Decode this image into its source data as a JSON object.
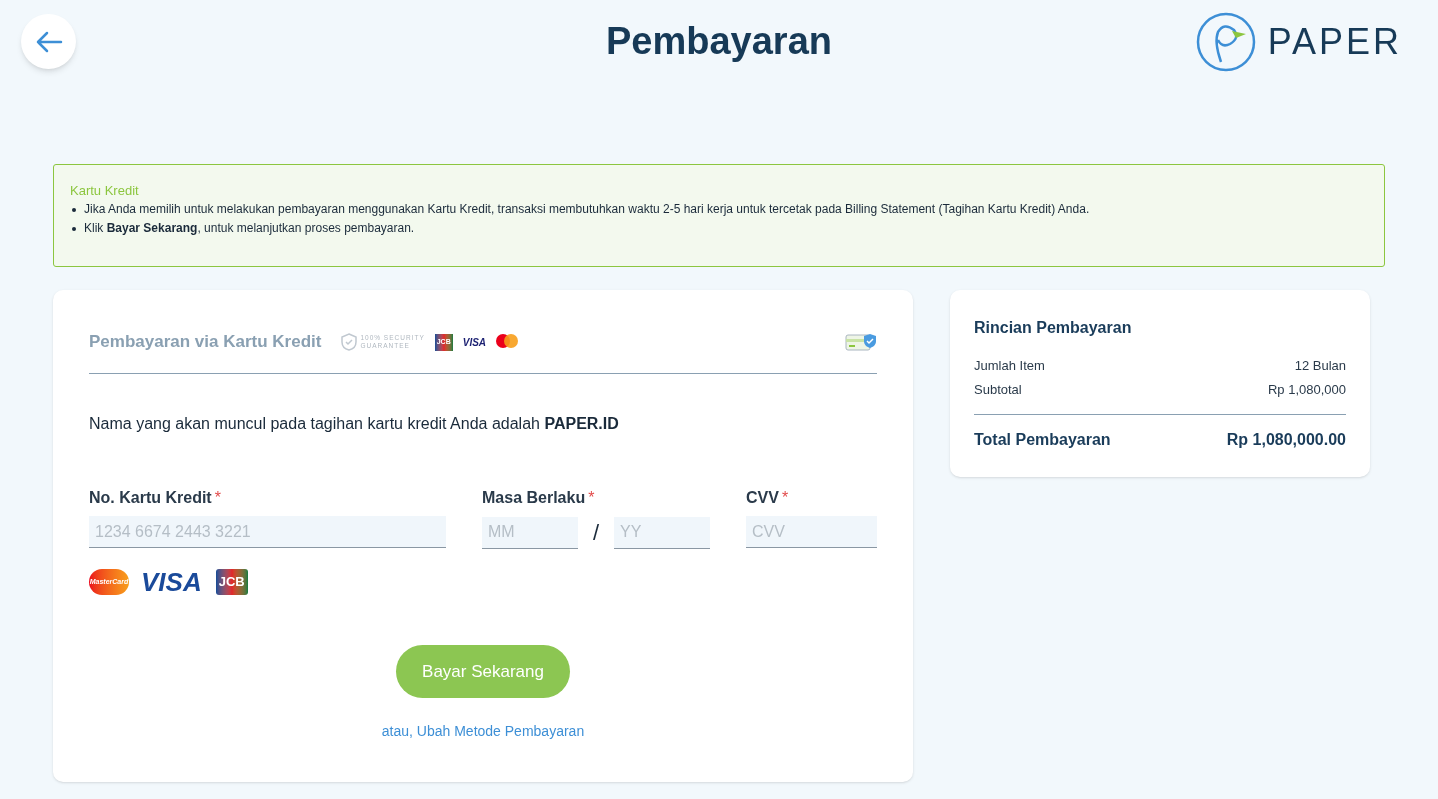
{
  "header": {
    "title": "Pembayaran",
    "logo_text": "PAPER"
  },
  "notice": {
    "title": "Kartu Kredit",
    "items": [
      "Jika Anda memilih untuk melakukan pembayaran menggunakan Kartu Kredit, transaksi membutuhkan waktu 2-5 hari kerja untuk tercetak pada Billing Statement (Tagihan Kartu Kredit) Anda.",
      "Klik **Bayar Sekarang**, untuk melanjutkan proses pembayaran."
    ]
  },
  "payment": {
    "title": "Pembayaran via Kartu Kredit",
    "security_badge": [
      "100% SECURITY",
      "GUARANTEE"
    ],
    "header_logos": [
      "JCB",
      "VISA"
    ],
    "statement": "Nama yang akan muncul pada tagihan kartu kredit Anda adalah **PAPER.ID**",
    "fields": [
      {
        "label": "No. Kartu Kredit",
        "required_mark": "*",
        "placeholder": "1234 6674 2443 3221"
      },
      {
        "label": "Masa Berlaku",
        "required_mark": "*",
        "placeholders": [
          "MM",
          "YY"
        ],
        "separator": "/"
      },
      {
        "label": "CVV",
        "required_mark": "*",
        "placeholder": "CVV"
      }
    ],
    "card_logos": [
      "MasterCard",
      "VISA",
      "JCB"
    ],
    "submit": "Bayar Sekarang",
    "alt_link": "atau, Ubah Metode Pembayaran"
  },
  "summary": {
    "title": "Rincian Pembayaran",
    "rows": [
      {
        "label": "Jumlah Item",
        "value": "12 Bulan"
      },
      {
        "label": "Subtotal",
        "value": "Rp 1,080,000"
      }
    ],
    "total": {
      "label": "Total Pembayaran",
      "value": "Rp 1,080,000.00"
    }
  }
}
